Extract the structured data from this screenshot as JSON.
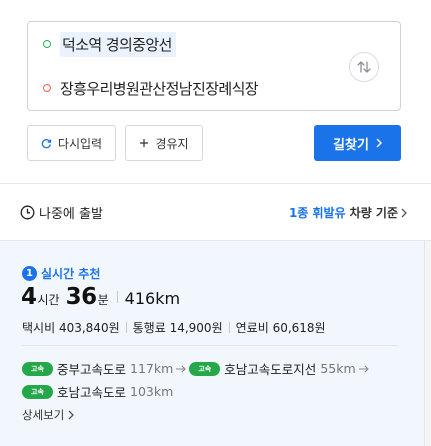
{
  "route": {
    "start": "덕소역 경의중앙선",
    "destination": "장흥우리병원관산정남진장례식장"
  },
  "actions": {
    "reset_label": "다시입력",
    "waypoint_label": "경유지",
    "search_label": "길찾기"
  },
  "options": {
    "depart_later_label": "나중에 출발",
    "fuel_basis_highlight": "1종 휘발유",
    "fuel_basis_text": "차량 기준"
  },
  "result": {
    "rank": "1",
    "badge_label": "실시간 추천",
    "hours": "4",
    "hours_unit": "시간",
    "minutes": "36",
    "minutes_unit": "분",
    "distance": "416km",
    "costs": [
      {
        "label": "택시비",
        "value": "403,840원"
      },
      {
        "label": "통행료",
        "value": "14,900원"
      },
      {
        "label": "연료비",
        "value": "60,618원"
      }
    ],
    "roads_line1": [
      {
        "badge": "고속",
        "name": "중부고속도로",
        "distance": "117km"
      },
      {
        "badge": "고속",
        "name": "호남고속도로지선",
        "distance": "55km"
      }
    ],
    "roads_line2": [
      {
        "badge": "고속",
        "name": "호남고속도로",
        "distance": "103km"
      }
    ],
    "details_label": "상세보기"
  },
  "colors": {
    "accent": "#1a73e8",
    "start_dot": "#1fb35a",
    "end_dot": "#f0625c",
    "highway_badge": "#26a84a",
    "card_background": "#f2f7fe"
  },
  "icons": {
    "swap": "swap-vertical-icon",
    "reset": "refresh-icon",
    "waypoint": "plus-icon",
    "clock": "clock-icon",
    "chevron": "chevron-right-icon",
    "arrow": "arrow-right-icon"
  }
}
